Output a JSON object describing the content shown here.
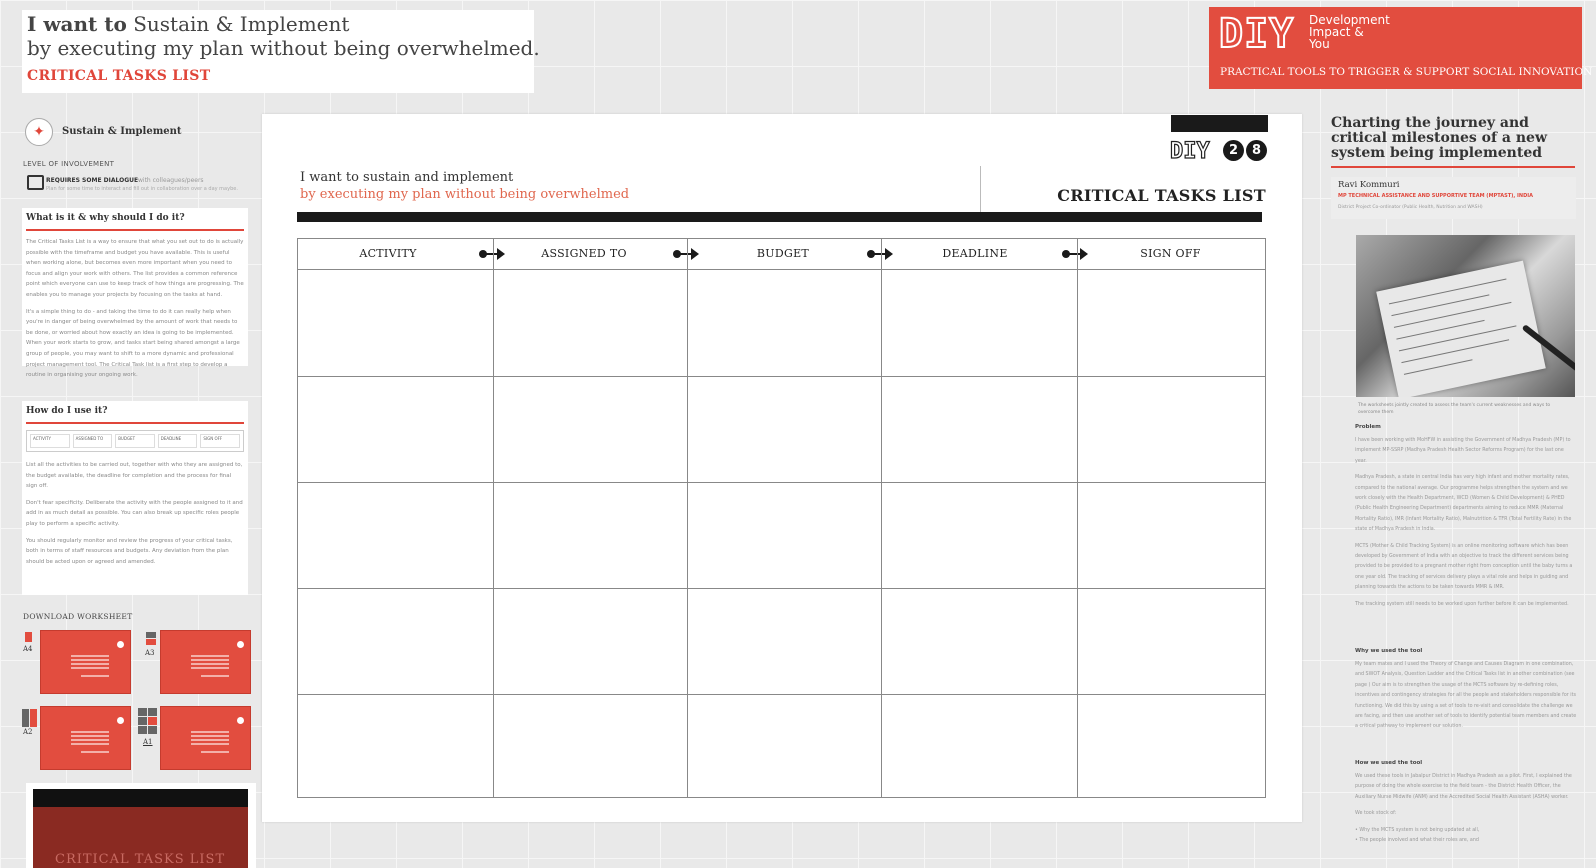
{
  "header": {
    "line1_bold": "I want to",
    "line1_rest": "Sustain & Implement",
    "line2": "by executing my plan without being overwhelmed.",
    "subtitle": "CRITICAL TASKS LIST"
  },
  "brand": {
    "logo": "DIY",
    "name_lines": [
      "Development",
      "Impact &",
      "You"
    ],
    "tagline": "PRACTICAL TOOLS TO TRIGGER & SUPPORT SOCIAL INNOVATION",
    "color": "#e24d3f"
  },
  "sidebar": {
    "phase": "Sustain & Implement",
    "phase_icon": "running-figure-icon",
    "involvement_label": "LEVEL OF INVOLVEMENT",
    "involvement_title": "REQUIRES SOME DIALOGUE",
    "involvement_sub": "with colleagues/peers",
    "involvement_desc": "Plan for some time to interact and fill out in collaboration over a day maybe.",
    "what": {
      "heading": "What is it & why should I do it?",
      "p1": "The Critical Tasks List is a way to ensure that what you set out to do is actually possible with the timeframe and budget you have available. This is useful when working alone, but becomes even more important when you need to focus and align your work with others. The list provides a common reference point which everyone can use to keep track of how things are progressing. The enables you to manage your projects by focusing on the tasks at hand.",
      "p2": "It's a simple thing to do - and taking the time to do it can really help when you're in danger of being overwhelmed by the amount of work that needs to be done, or worried about how exactly an idea is going to be implemented. When your work starts to grow, and tasks start being shared amongst a large group of people, you may want to shift to a more dynamic and professional project management tool. The Critical Task list is a first step to develop a routine in organising your ongoing work."
    },
    "how": {
      "heading": "How do I use it?",
      "mini_cols": [
        "ACTIVITY",
        "ASSIGNED TO",
        "BUDGET",
        "DEADLINE",
        "SIGN OFF"
      ],
      "p1": "List all the activities to be carried out, together with who they are assigned to, the budget available, the deadline for completion and the process for final sign off.",
      "p2": "Don't fear specificity. Deliberate the activity with the people assigned to it and add in as much detail as possible. You can also break up specific roles people play to perform a specific activity.",
      "p3": "You should regularly monitor and review the progress of your critical tasks, both in terms of staff resources and budgets. Any deviation from the plan should be acted upon or agreed and amended."
    },
    "download_label": "DOWNLOAD WORKSHEET",
    "downloads": [
      {
        "size": "A4"
      },
      {
        "size": "A3"
      },
      {
        "size": "A2"
      },
      {
        "size": "A1"
      }
    ],
    "promo_text": "CRITICAL TASKS LIST"
  },
  "worksheet": {
    "logo": "DIY",
    "numbers": [
      "2",
      "8"
    ],
    "line1": "I want to sustain and implement",
    "line2": "by executing my plan without being overwhelmed",
    "title": "CRITICAL TASKS LIST",
    "columns": [
      "ACTIVITY",
      "ASSIGNED TO",
      "BUDGET",
      "DEADLINE",
      "SIGN OFF"
    ],
    "row_count": 5
  },
  "case": {
    "title": "Charting the journey and critical milestones of a new system being implemented",
    "author": "Ravi Kommuri",
    "team": "MP TECHNICAL ASSISTANCE AND SUPPORTIVE TEAM (MPTAST), INDIA",
    "role": "District Project Co-ordinator (Public Health, Nutrition and WASH)",
    "photo_caption": "The worksheets jointly created to assess the team's current weaknesses and ways to overcome them",
    "sections": [
      {
        "heading": "Problem",
        "paras": [
          "I have been working with MoHFW in assisting the Government of Madhya Pradesh (MP) to implement MP-SSRP (Madhya Pradesh Health Sector Reforms Program) for the last one year.",
          "Madhya Pradesh, a state in central India has very high infant and mother mortality rates, compared to the national average. Our programme helps strengthen the system and we work closely with the Health Department, WCD (Women & Child Development) & PHED (Public Health Engineering Department) departments aiming to reduce MMR (Maternal Mortality Ratio), IMR (Infant Mortality Ratio), Malnutrition & TFR (Total Fertility Rate) in the state of Madhya Pradesh in India.",
          "MCTS (Mother & Child Tracking System) is an online monitoring software which has been developed by Government of India with an objective to track the different services being provided to be provided to a pregnant mother right from conception until the baby turns a one year old. The tracking of services delivery plays a vital role and helps in guiding and planning towards the actions to be taken towards MMR & IMR.",
          "The tracking system still needs to be worked upon further before it can be implemented."
        ]
      },
      {
        "heading": "Why we used the tool",
        "paras": [
          "My team mates and I used the Theory of Change and Causes Diagram in one combination, and SWOT Analysis, Question Ladder and the Critical Tasks list in another combination (see page ) Our aim is to strengthen the usage of the MCTS software by re-defining roles, incentives and contingency strategies for all the people and stakeholders responsible for its functioning. We did this by using a set of tools to re-visit and consolidate the challenge we are facing, and then use another set of tools to identify potential team members and create a critical pathway to implement our solution."
        ]
      },
      {
        "heading": "How we used the tool",
        "paras": [
          "We used these tools in Jabalpur District in Madhya Pradesh as a pilot. First, I explained the purpose of doing the whole exercise to the field team - the District Health Officer, the Auxiliary Nurse Midwife (ANM) and the Accredited Social Health Assistant (ASHA) worker.",
          "We took stock of:",
          "• Why the MCTS system is not being updated at all,",
          "• The people involved and what their roles are, and"
        ]
      }
    ]
  }
}
